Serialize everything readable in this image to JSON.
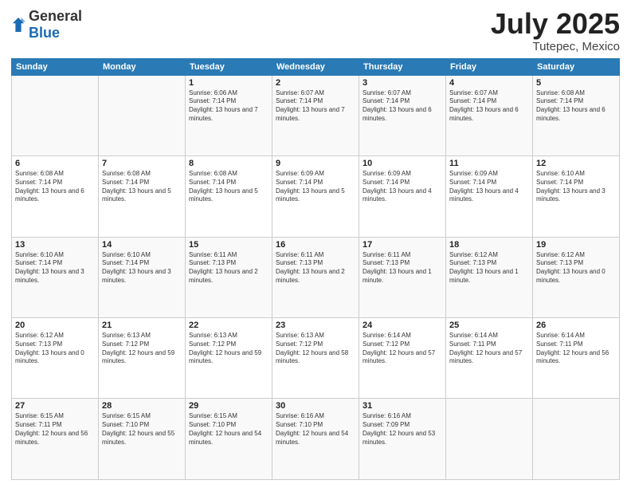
{
  "header": {
    "logo_general": "General",
    "logo_blue": "Blue",
    "month": "July 2025",
    "location": "Tutepec, Mexico"
  },
  "weekdays": [
    "Sunday",
    "Monday",
    "Tuesday",
    "Wednesday",
    "Thursday",
    "Friday",
    "Saturday"
  ],
  "weeks": [
    [
      {
        "day": "",
        "info": ""
      },
      {
        "day": "",
        "info": ""
      },
      {
        "day": "1",
        "info": "Sunrise: 6:06 AM\nSunset: 7:14 PM\nDaylight: 13 hours and 7 minutes."
      },
      {
        "day": "2",
        "info": "Sunrise: 6:07 AM\nSunset: 7:14 PM\nDaylight: 13 hours and 7 minutes."
      },
      {
        "day": "3",
        "info": "Sunrise: 6:07 AM\nSunset: 7:14 PM\nDaylight: 13 hours and 6 minutes."
      },
      {
        "day": "4",
        "info": "Sunrise: 6:07 AM\nSunset: 7:14 PM\nDaylight: 13 hours and 6 minutes."
      },
      {
        "day": "5",
        "info": "Sunrise: 6:08 AM\nSunset: 7:14 PM\nDaylight: 13 hours and 6 minutes."
      }
    ],
    [
      {
        "day": "6",
        "info": "Sunrise: 6:08 AM\nSunset: 7:14 PM\nDaylight: 13 hours and 6 minutes."
      },
      {
        "day": "7",
        "info": "Sunrise: 6:08 AM\nSunset: 7:14 PM\nDaylight: 13 hours and 5 minutes."
      },
      {
        "day": "8",
        "info": "Sunrise: 6:08 AM\nSunset: 7:14 PM\nDaylight: 13 hours and 5 minutes."
      },
      {
        "day": "9",
        "info": "Sunrise: 6:09 AM\nSunset: 7:14 PM\nDaylight: 13 hours and 5 minutes."
      },
      {
        "day": "10",
        "info": "Sunrise: 6:09 AM\nSunset: 7:14 PM\nDaylight: 13 hours and 4 minutes."
      },
      {
        "day": "11",
        "info": "Sunrise: 6:09 AM\nSunset: 7:14 PM\nDaylight: 13 hours and 4 minutes."
      },
      {
        "day": "12",
        "info": "Sunrise: 6:10 AM\nSunset: 7:14 PM\nDaylight: 13 hours and 3 minutes."
      }
    ],
    [
      {
        "day": "13",
        "info": "Sunrise: 6:10 AM\nSunset: 7:14 PM\nDaylight: 13 hours and 3 minutes."
      },
      {
        "day": "14",
        "info": "Sunrise: 6:10 AM\nSunset: 7:14 PM\nDaylight: 13 hours and 3 minutes."
      },
      {
        "day": "15",
        "info": "Sunrise: 6:11 AM\nSunset: 7:13 PM\nDaylight: 13 hours and 2 minutes."
      },
      {
        "day": "16",
        "info": "Sunrise: 6:11 AM\nSunset: 7:13 PM\nDaylight: 13 hours and 2 minutes."
      },
      {
        "day": "17",
        "info": "Sunrise: 6:11 AM\nSunset: 7:13 PM\nDaylight: 13 hours and 1 minute."
      },
      {
        "day": "18",
        "info": "Sunrise: 6:12 AM\nSunset: 7:13 PM\nDaylight: 13 hours and 1 minute."
      },
      {
        "day": "19",
        "info": "Sunrise: 6:12 AM\nSunset: 7:13 PM\nDaylight: 13 hours and 0 minutes."
      }
    ],
    [
      {
        "day": "20",
        "info": "Sunrise: 6:12 AM\nSunset: 7:13 PM\nDaylight: 13 hours and 0 minutes."
      },
      {
        "day": "21",
        "info": "Sunrise: 6:13 AM\nSunset: 7:12 PM\nDaylight: 12 hours and 59 minutes."
      },
      {
        "day": "22",
        "info": "Sunrise: 6:13 AM\nSunset: 7:12 PM\nDaylight: 12 hours and 59 minutes."
      },
      {
        "day": "23",
        "info": "Sunrise: 6:13 AM\nSunset: 7:12 PM\nDaylight: 12 hours and 58 minutes."
      },
      {
        "day": "24",
        "info": "Sunrise: 6:14 AM\nSunset: 7:12 PM\nDaylight: 12 hours and 57 minutes."
      },
      {
        "day": "25",
        "info": "Sunrise: 6:14 AM\nSunset: 7:11 PM\nDaylight: 12 hours and 57 minutes."
      },
      {
        "day": "26",
        "info": "Sunrise: 6:14 AM\nSunset: 7:11 PM\nDaylight: 12 hours and 56 minutes."
      }
    ],
    [
      {
        "day": "27",
        "info": "Sunrise: 6:15 AM\nSunset: 7:11 PM\nDaylight: 12 hours and 56 minutes."
      },
      {
        "day": "28",
        "info": "Sunrise: 6:15 AM\nSunset: 7:10 PM\nDaylight: 12 hours and 55 minutes."
      },
      {
        "day": "29",
        "info": "Sunrise: 6:15 AM\nSunset: 7:10 PM\nDaylight: 12 hours and 54 minutes."
      },
      {
        "day": "30",
        "info": "Sunrise: 6:16 AM\nSunset: 7:10 PM\nDaylight: 12 hours and 54 minutes."
      },
      {
        "day": "31",
        "info": "Sunrise: 6:16 AM\nSunset: 7:09 PM\nDaylight: 12 hours and 53 minutes."
      },
      {
        "day": "",
        "info": ""
      },
      {
        "day": "",
        "info": ""
      }
    ]
  ]
}
